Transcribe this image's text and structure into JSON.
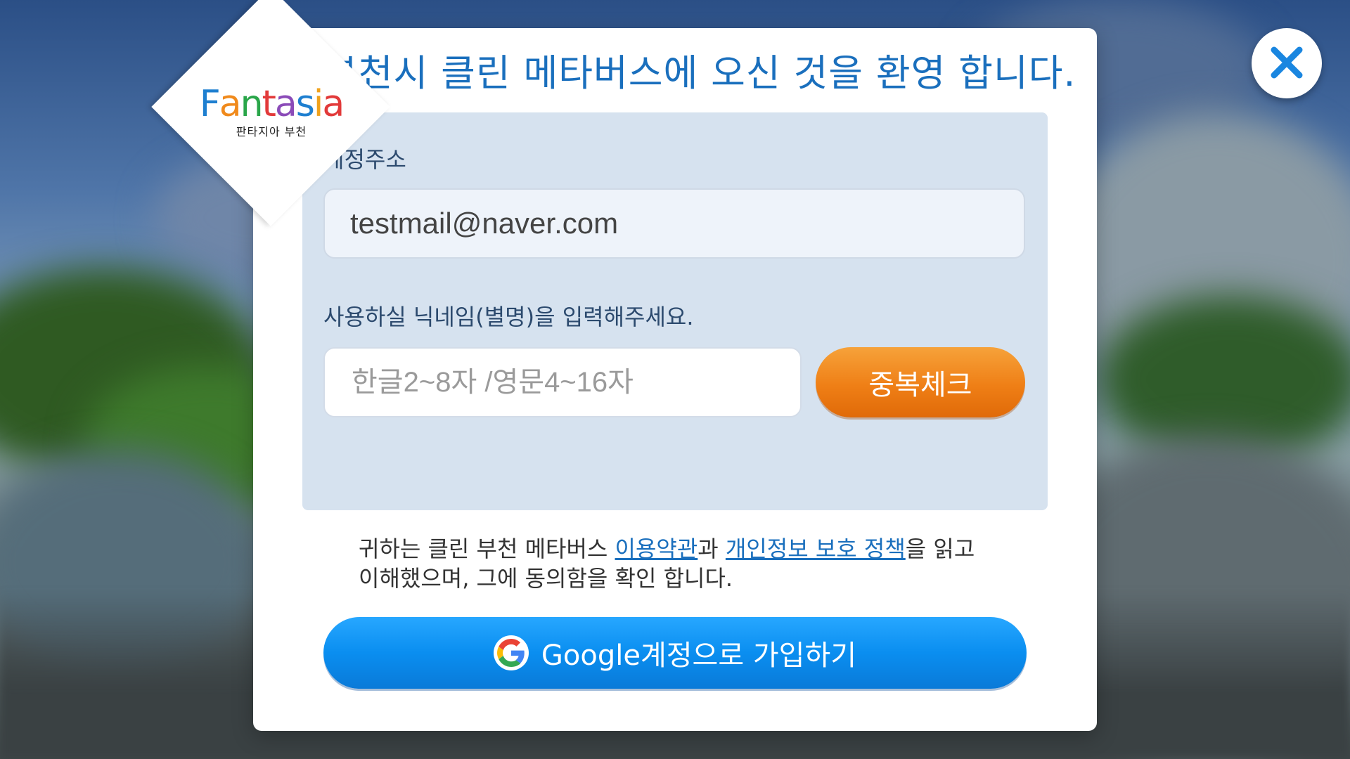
{
  "logo": {
    "word": "Fantasia",
    "subtitle": "판타지아 부천"
  },
  "title": "부천시 클린 메타버스에 오신 것을 환영 합니다.",
  "form": {
    "email_label": "계정주소",
    "email_value": "testmail@naver.com",
    "nickname_label": "사용하실 닉네임(별명)을 입력해주세요.",
    "nickname_placeholder": "한글2~8자 /영문4~16자",
    "duplicate_check_label": "중복체크"
  },
  "consent": {
    "prefix": "귀하는 클린 부천 메타버스 ",
    "terms_link": "이용약관",
    "connector": "과 ",
    "privacy_link": "개인정보 보호 정책",
    "suffix_line1": "을 읽고",
    "line2": "이해했으며, 그에 동의함을 확인 합니다."
  },
  "google_button": {
    "label": "Google계정으로 가입하기",
    "icon": "google-g-icon"
  },
  "close_button": {
    "icon": "close-x-icon"
  },
  "colors": {
    "title": "#1a6fbd",
    "panel": "#d6e2ef",
    "orange_button": "#ef7f16",
    "google_button": "#0a8ef0",
    "link": "#1a6fbd"
  }
}
